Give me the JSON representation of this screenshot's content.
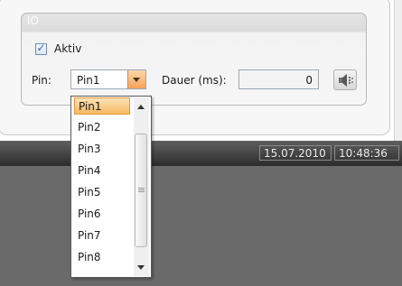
{
  "group": {
    "title": "IO"
  },
  "aktiv": {
    "label": "Aktiv",
    "checked": true
  },
  "pin": {
    "label": "Pin:",
    "value": "Pin1"
  },
  "dauer": {
    "label": "Dauer (ms):",
    "value": "0"
  },
  "sound_button": {
    "icon": "speaker-icon"
  },
  "status": {
    "date": "15.07.2010",
    "time": "10:48:36"
  },
  "dropdown": {
    "items": [
      "Pin1",
      "Pin2",
      "Pin3",
      "Pin4",
      "Pin5",
      "Pin6",
      "Pin7",
      "Pin8"
    ],
    "selected_index": 0
  },
  "colors": {
    "selection": "#f8b864",
    "statusbar": "#3a3a3a",
    "background_lower": "#6a6a6a"
  }
}
